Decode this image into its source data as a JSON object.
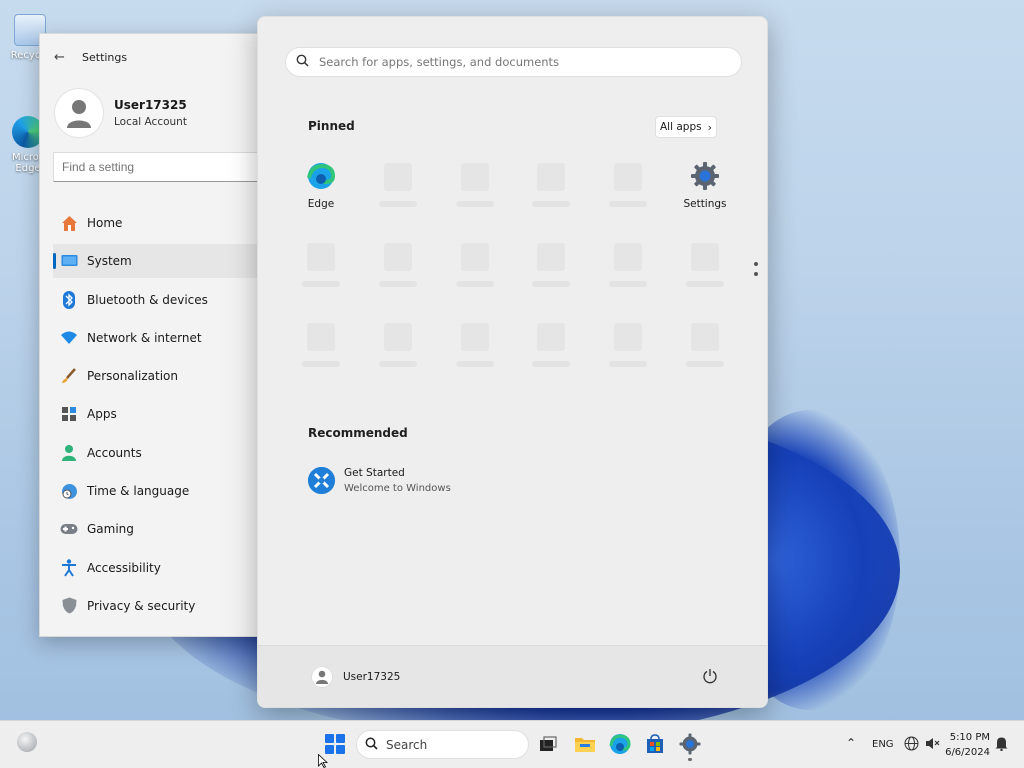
{
  "desktop": {
    "icons": [
      {
        "label": "Recycle",
        "icon": "recycle-bin-icon"
      },
      {
        "label": "Micros Edge",
        "icon": "edge-icon"
      }
    ]
  },
  "settings_window": {
    "title": "Settings",
    "user": {
      "name": "User17325",
      "account_type": "Local Account"
    },
    "search_placeholder": "Find a setting",
    "nav": [
      {
        "label": "Home",
        "icon": "home-icon",
        "selected": false
      },
      {
        "label": "System",
        "icon": "monitor-icon",
        "selected": true
      },
      {
        "label": "Bluetooth & devices",
        "icon": "bluetooth-icon",
        "selected": false
      },
      {
        "label": "Network & internet",
        "icon": "wifi-icon",
        "selected": false
      },
      {
        "label": "Personalization",
        "icon": "brush-icon",
        "selected": false
      },
      {
        "label": "Apps",
        "icon": "apps-icon",
        "selected": false
      },
      {
        "label": "Accounts",
        "icon": "person-icon",
        "selected": false
      },
      {
        "label": "Time & language",
        "icon": "globe-clock-icon",
        "selected": false
      },
      {
        "label": "Gaming",
        "icon": "gamepad-icon",
        "selected": false
      },
      {
        "label": "Accessibility",
        "icon": "accessibility-icon",
        "selected": false
      },
      {
        "label": "Privacy & security",
        "icon": "shield-icon",
        "selected": false
      }
    ]
  },
  "start_menu": {
    "search_placeholder": "Search for apps, settings, and documents",
    "pinned_title": "Pinned",
    "all_apps_label": "All apps",
    "pinned": [
      {
        "label": "Edge",
        "icon": "edge-icon"
      },
      {
        "label": "Settings",
        "icon": "gear-icon"
      }
    ],
    "recommended_title": "Recommended",
    "recommended": [
      {
        "title": "Get Started",
        "subtitle": "Welcome to Windows",
        "icon": "get-started-icon"
      }
    ],
    "footer_user": "User17325"
  },
  "taskbar": {
    "search_label": "Search",
    "language": "ENG",
    "time": "5:10 PM",
    "date": "6/6/2024"
  },
  "colors": {
    "accent": "#0067c0",
    "windows_blue": "#1a73e8"
  }
}
